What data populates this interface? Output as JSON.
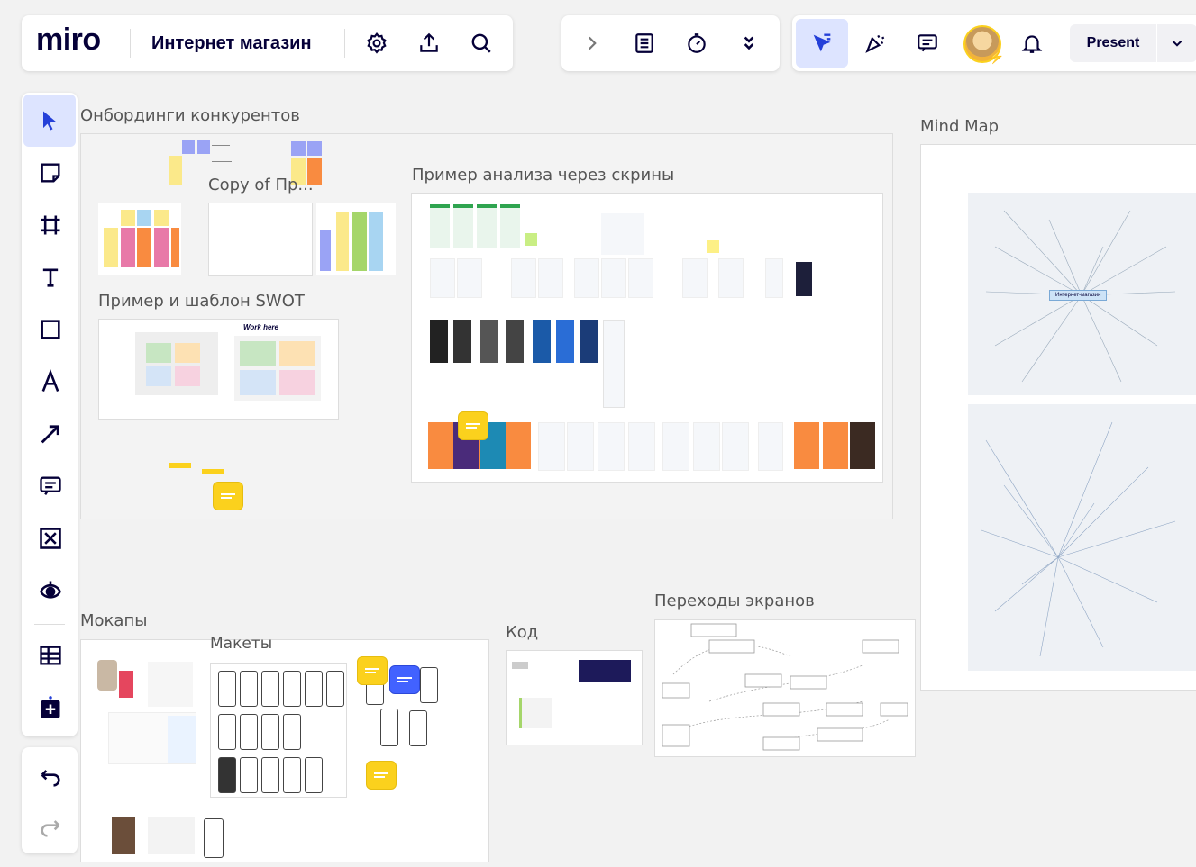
{
  "app": {
    "logo": "miro",
    "board_title": "Интернет магазин"
  },
  "topbar": {
    "present_label": "Present"
  },
  "frames": {
    "onboarding": "Онбординги конкурентов",
    "copy_of": "Copy of Пр...",
    "screens_analysis": "Пример анализа через скрины",
    "swot": "Пример и шаблон SWOT",
    "swot_work_here": "Work here",
    "mind_map": "Mind Map",
    "mockups": "Мокапы",
    "layouts": "Макеты",
    "code": "Код",
    "transitions": "Переходы экранов",
    "mindmap_center": "Интернет-магазин"
  },
  "colors": {
    "accent": "#4262ff",
    "sticky_yellow": "#fbd11d",
    "chat_blue": "#4262ff",
    "orange": "#f98b40",
    "pink": "#e879a8",
    "lightblue": "#a8d5f2",
    "green": "#a5d66a",
    "purple": "#9aa3f5"
  },
  "icons": [
    "settings-icon",
    "share-icon",
    "search-icon",
    "chevron-right-icon",
    "notes-icon",
    "timer-icon",
    "more-chevron-icon",
    "select-cursor-icon",
    "reactions-icon",
    "comments-icon",
    "bell-icon",
    "dropdown-icon",
    "cursor-icon",
    "sticky-note-icon",
    "frame-icon",
    "text-icon",
    "shape-icon",
    "pen-icon",
    "arrow-icon",
    "comment-icon",
    "crop-icon",
    "eye-icon",
    "table-icon",
    "add-app-icon",
    "undo-icon",
    "redo-icon"
  ]
}
